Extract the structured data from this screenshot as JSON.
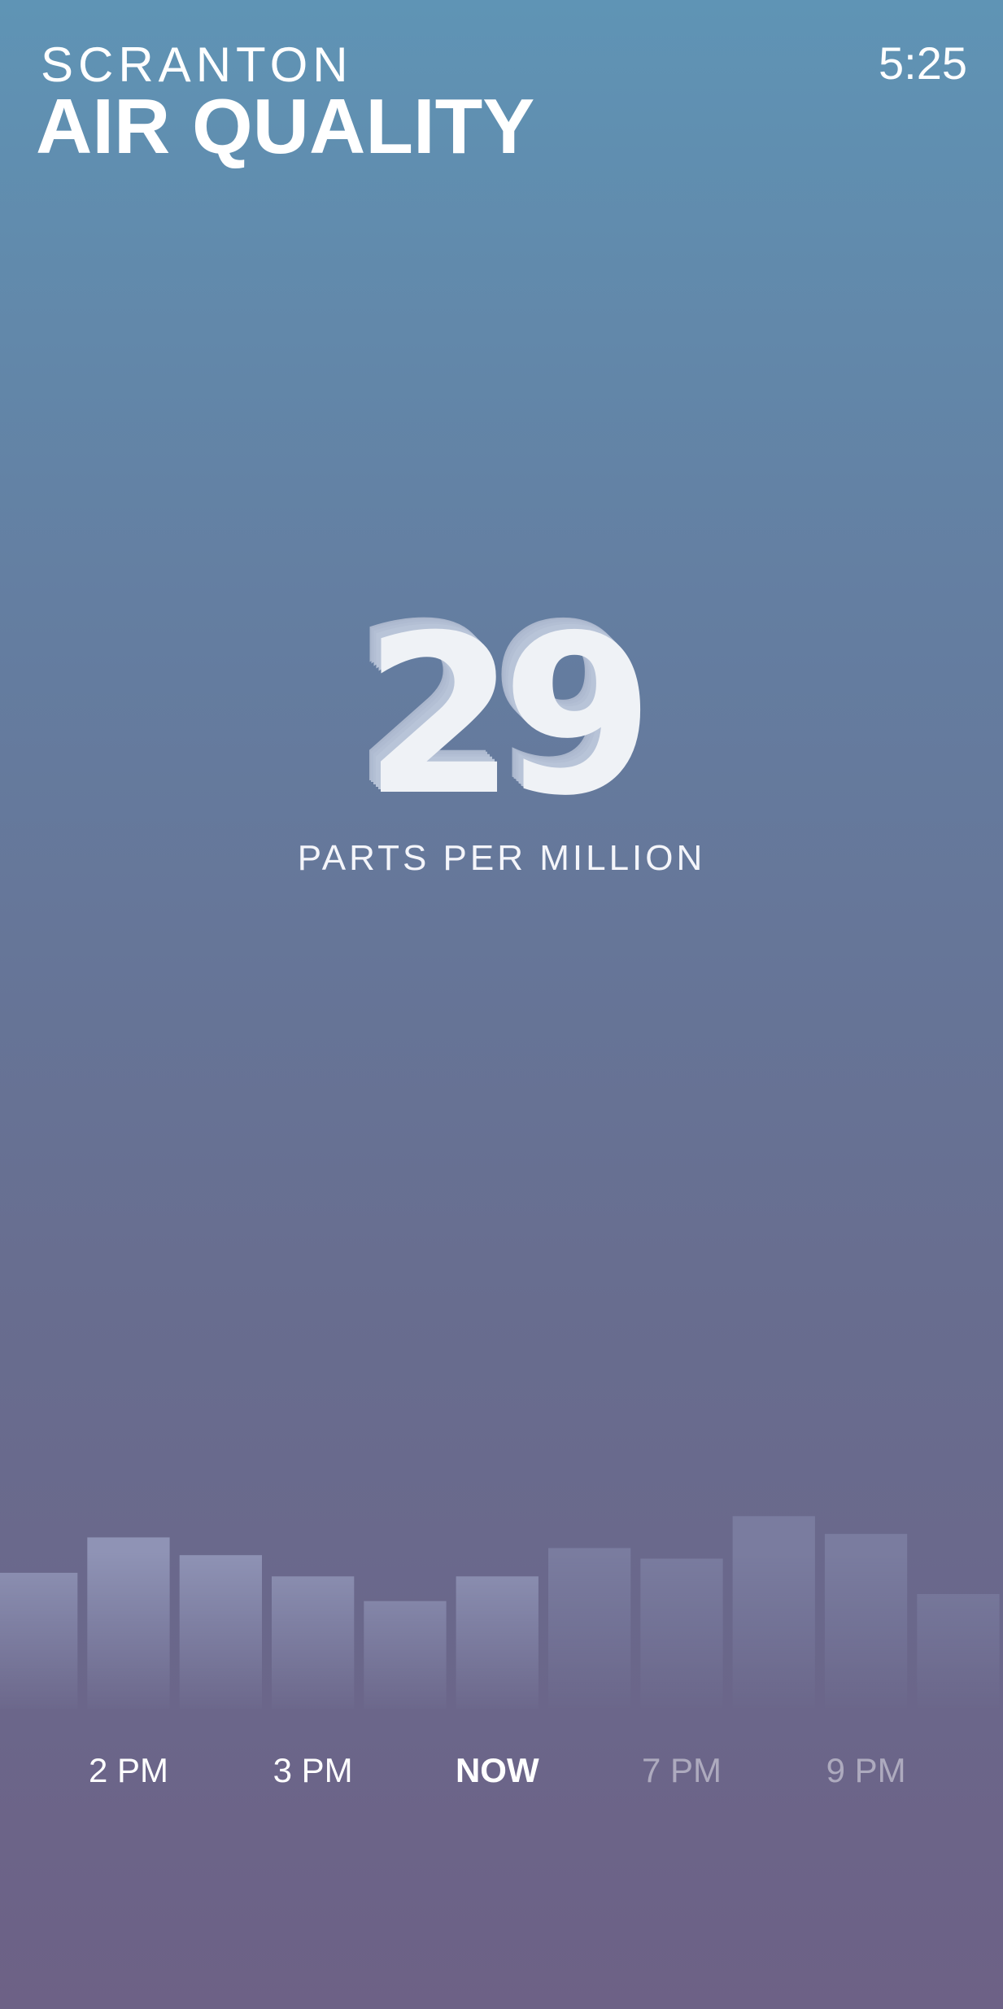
{
  "header": {
    "city": "SCRANTON",
    "title": "AIR QUALITY"
  },
  "clock": "5:25",
  "reading": {
    "value": "29",
    "unit": "PARTS PER MILLION"
  },
  "colors": {
    "bar_past": "#8f93b5",
    "bar_future": "#7a7c9f",
    "reading_face": "#eff2f6",
    "reading_side": "#b8c4d8"
  },
  "chart_data": {
    "type": "bar",
    "series": [
      {
        "values": [
          33,
          38,
          35.5,
          32.5,
          29,
          32.5,
          36.5,
          35,
          41,
          38.5,
          30
        ]
      }
    ],
    "current_index": 5,
    "ylim": [
      0,
      50
    ],
    "grid": false,
    "legend": "none"
  },
  "time_labels": [
    {
      "label": "2 PM",
      "state": "past",
      "bar": 1
    },
    {
      "label": "3 PM",
      "state": "past",
      "bar": 3
    },
    {
      "label": "NOW",
      "state": "now",
      "bar": 5
    },
    {
      "label": "7 PM",
      "state": "future",
      "bar": 7
    },
    {
      "label": "9 PM",
      "state": "future",
      "bar": 9
    }
  ]
}
